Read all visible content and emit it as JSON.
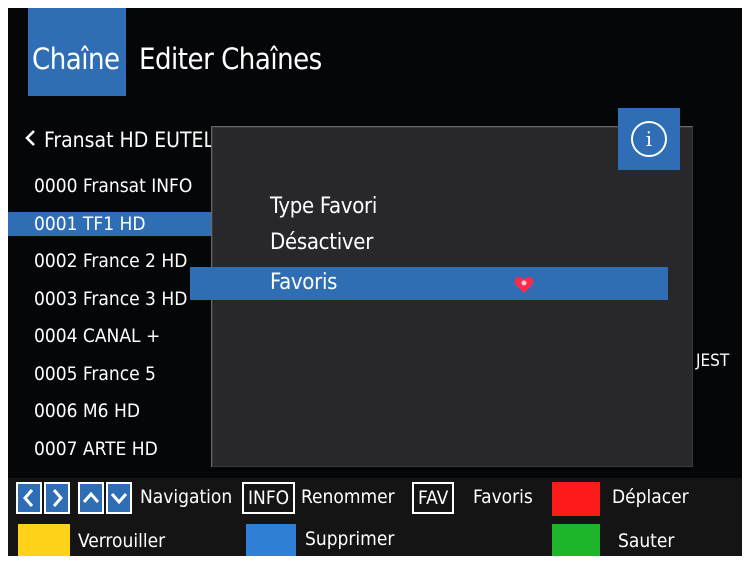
{
  "header": {
    "tab_active": "Chaîne",
    "tab_other": "Editer Chaînes"
  },
  "breadcrumb": "Fransat HD EUTELSAT",
  "channels": [
    "0000 Fransat INFO",
    "0001 TF1 HD",
    "0002 France 2 HD",
    "0003 France 3 HD",
    "0004 CANAL +",
    "0005 France 5",
    "0006 M6 HD",
    "0007 ARTE HD"
  ],
  "selected_channel_index": 1,
  "side_text": "JEST",
  "popup": {
    "items": [
      "Type Favori",
      "Désactiver",
      "Favoris"
    ],
    "selected_index": 2,
    "info_icon": "i"
  },
  "footer": {
    "nav_label": "Navigation",
    "info_key": "INFO",
    "info_label": "Renommer",
    "fav_key": "FAV",
    "fav_label": "Favoris",
    "red_label": "Déplacer",
    "yellow_label": "Verrouiller",
    "blue_label": "Supprimer",
    "green_label": "Sauter"
  },
  "colors": {
    "accent": "#2f6db5",
    "red": "#ff1a1a",
    "yellow": "#ffd21a",
    "blue": "#2f7fd6",
    "green": "#1fb52a",
    "heart": "#ff2a4a"
  }
}
